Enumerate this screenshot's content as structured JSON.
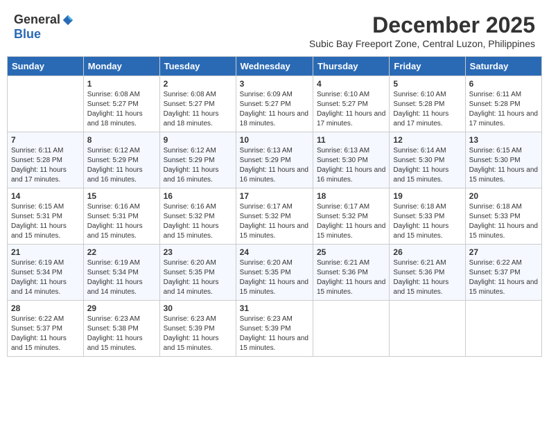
{
  "logo": {
    "general": "General",
    "blue": "Blue"
  },
  "title": "December 2025",
  "subtitle": "Subic Bay Freeport Zone, Central Luzon, Philippines",
  "headers": [
    "Sunday",
    "Monday",
    "Tuesday",
    "Wednesday",
    "Thursday",
    "Friday",
    "Saturday"
  ],
  "weeks": [
    [
      {
        "day": "",
        "info": ""
      },
      {
        "day": "1",
        "info": "Sunrise: 6:08 AM\nSunset: 5:27 PM\nDaylight: 11 hours and 18 minutes."
      },
      {
        "day": "2",
        "info": "Sunrise: 6:08 AM\nSunset: 5:27 PM\nDaylight: 11 hours and 18 minutes."
      },
      {
        "day": "3",
        "info": "Sunrise: 6:09 AM\nSunset: 5:27 PM\nDaylight: 11 hours and 18 minutes."
      },
      {
        "day": "4",
        "info": "Sunrise: 6:10 AM\nSunset: 5:27 PM\nDaylight: 11 hours and 17 minutes."
      },
      {
        "day": "5",
        "info": "Sunrise: 6:10 AM\nSunset: 5:28 PM\nDaylight: 11 hours and 17 minutes."
      },
      {
        "day": "6",
        "info": "Sunrise: 6:11 AM\nSunset: 5:28 PM\nDaylight: 11 hours and 17 minutes."
      }
    ],
    [
      {
        "day": "7",
        "info": "Sunrise: 6:11 AM\nSunset: 5:28 PM\nDaylight: 11 hours and 17 minutes."
      },
      {
        "day": "8",
        "info": "Sunrise: 6:12 AM\nSunset: 5:29 PM\nDaylight: 11 hours and 16 minutes."
      },
      {
        "day": "9",
        "info": "Sunrise: 6:12 AM\nSunset: 5:29 PM\nDaylight: 11 hours and 16 minutes."
      },
      {
        "day": "10",
        "info": "Sunrise: 6:13 AM\nSunset: 5:29 PM\nDaylight: 11 hours and 16 minutes."
      },
      {
        "day": "11",
        "info": "Sunrise: 6:13 AM\nSunset: 5:30 PM\nDaylight: 11 hours and 16 minutes."
      },
      {
        "day": "12",
        "info": "Sunrise: 6:14 AM\nSunset: 5:30 PM\nDaylight: 11 hours and 15 minutes."
      },
      {
        "day": "13",
        "info": "Sunrise: 6:15 AM\nSunset: 5:30 PM\nDaylight: 11 hours and 15 minutes."
      }
    ],
    [
      {
        "day": "14",
        "info": "Sunrise: 6:15 AM\nSunset: 5:31 PM\nDaylight: 11 hours and 15 minutes."
      },
      {
        "day": "15",
        "info": "Sunrise: 6:16 AM\nSunset: 5:31 PM\nDaylight: 11 hours and 15 minutes."
      },
      {
        "day": "16",
        "info": "Sunrise: 6:16 AM\nSunset: 5:32 PM\nDaylight: 11 hours and 15 minutes."
      },
      {
        "day": "17",
        "info": "Sunrise: 6:17 AM\nSunset: 5:32 PM\nDaylight: 11 hours and 15 minutes."
      },
      {
        "day": "18",
        "info": "Sunrise: 6:17 AM\nSunset: 5:32 PM\nDaylight: 11 hours and 15 minutes."
      },
      {
        "day": "19",
        "info": "Sunrise: 6:18 AM\nSunset: 5:33 PM\nDaylight: 11 hours and 15 minutes."
      },
      {
        "day": "20",
        "info": "Sunrise: 6:18 AM\nSunset: 5:33 PM\nDaylight: 11 hours and 15 minutes."
      }
    ],
    [
      {
        "day": "21",
        "info": "Sunrise: 6:19 AM\nSunset: 5:34 PM\nDaylight: 11 hours and 14 minutes."
      },
      {
        "day": "22",
        "info": "Sunrise: 6:19 AM\nSunset: 5:34 PM\nDaylight: 11 hours and 14 minutes."
      },
      {
        "day": "23",
        "info": "Sunrise: 6:20 AM\nSunset: 5:35 PM\nDaylight: 11 hours and 14 minutes."
      },
      {
        "day": "24",
        "info": "Sunrise: 6:20 AM\nSunset: 5:35 PM\nDaylight: 11 hours and 15 minutes."
      },
      {
        "day": "25",
        "info": "Sunrise: 6:21 AM\nSunset: 5:36 PM\nDaylight: 11 hours and 15 minutes."
      },
      {
        "day": "26",
        "info": "Sunrise: 6:21 AM\nSunset: 5:36 PM\nDaylight: 11 hours and 15 minutes."
      },
      {
        "day": "27",
        "info": "Sunrise: 6:22 AM\nSunset: 5:37 PM\nDaylight: 11 hours and 15 minutes."
      }
    ],
    [
      {
        "day": "28",
        "info": "Sunrise: 6:22 AM\nSunset: 5:37 PM\nDaylight: 11 hours and 15 minutes."
      },
      {
        "day": "29",
        "info": "Sunrise: 6:23 AM\nSunset: 5:38 PM\nDaylight: 11 hours and 15 minutes."
      },
      {
        "day": "30",
        "info": "Sunrise: 6:23 AM\nSunset: 5:39 PM\nDaylight: 11 hours and 15 minutes."
      },
      {
        "day": "31",
        "info": "Sunrise: 6:23 AM\nSunset: 5:39 PM\nDaylight: 11 hours and 15 minutes."
      },
      {
        "day": "",
        "info": ""
      },
      {
        "day": "",
        "info": ""
      },
      {
        "day": "",
        "info": ""
      }
    ]
  ]
}
